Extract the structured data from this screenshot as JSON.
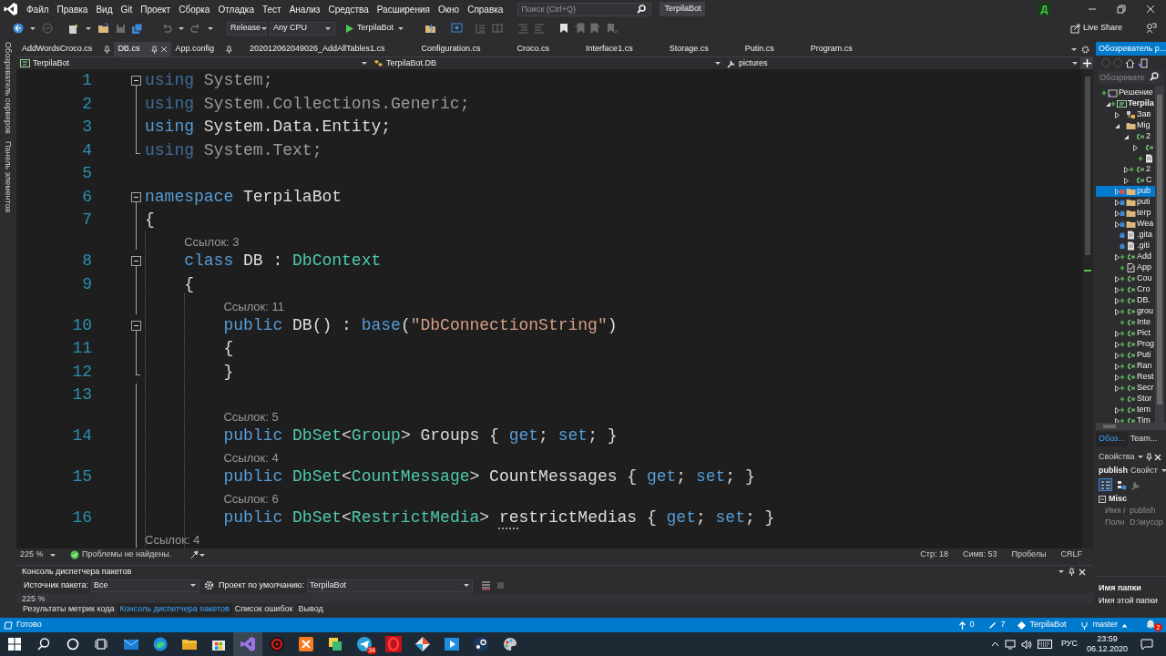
{
  "menu": {
    "items": [
      "Файл",
      "Правка",
      "Вид",
      "Git",
      "Проект",
      "Сборка",
      "Отладка",
      "Тест",
      "Анализ",
      "Средства",
      "Расширения",
      "Окно",
      "Справка"
    ],
    "search_placeholder": "Поиск (Ctrl+Q)",
    "solution_name": "TerpilaBot",
    "account_initial": "Д"
  },
  "toolbar": {
    "configuration": "Release",
    "platform": "Any CPU",
    "start": "TerpilaBot",
    "live_share": "Live Share"
  },
  "side_strip": [
    "Обозреватель серверов",
    "Панель элементов"
  ],
  "tabs": [
    {
      "label": "AddWordsCroco.cs",
      "pinned": true,
      "selected": false
    },
    {
      "label": "DB.cs",
      "pinned": true,
      "selected": true
    },
    {
      "label": "App.config",
      "pinned": true,
      "selected": false
    },
    {
      "label": "202012062049026_AddAllTables1.cs",
      "pinned": false,
      "selected": false
    },
    {
      "label": "Configuration.cs",
      "pinned": false,
      "selected": false
    },
    {
      "label": "Croco.cs",
      "pinned": false,
      "selected": false
    },
    {
      "label": "Interface1.cs",
      "pinned": false,
      "selected": false
    },
    {
      "label": "Storage.cs",
      "pinned": false,
      "selected": false
    },
    {
      "label": "Putin.cs",
      "pinned": false,
      "selected": false
    },
    {
      "label": "Program.cs",
      "pinned": false,
      "selected": false
    }
  ],
  "nav_bar": {
    "project": "TerpilaBot",
    "type": "TerpilaBot.DB",
    "member": "pictures"
  },
  "editor": {
    "lines": [
      {
        "kind": "code",
        "number": "1",
        "collapsible": true,
        "block_end": false,
        "in_block": true,
        "tokens": [
          {
            "kind": "kw_dim",
            "text": "using"
          },
          {
            "kind": "dim",
            "text": " System;"
          }
        ]
      },
      {
        "kind": "code",
        "number": "2",
        "collapsible": false,
        "block_end": false,
        "in_block": true,
        "tokens": [
          {
            "kind": "kw_dim",
            "text": "using"
          },
          {
            "kind": "dim",
            "text": " System.Collections.Generic;"
          }
        ]
      },
      {
        "kind": "code",
        "number": "3",
        "collapsible": false,
        "block_end": false,
        "in_block": true,
        "tokens": [
          {
            "kind": "kw",
            "text": "using"
          },
          {
            "kind": "text",
            "text": " System.Data.Entity;"
          }
        ]
      },
      {
        "kind": "code",
        "number": "4",
        "collapsible": false,
        "block_end": true,
        "in_block": true,
        "tokens": [
          {
            "kind": "kw_dim",
            "text": "using"
          },
          {
            "kind": "dim",
            "text": " System.Text;"
          }
        ]
      },
      {
        "kind": "code",
        "number": "5",
        "collapsible": false,
        "block_end": false,
        "in_block": false
      },
      {
        "kind": "code",
        "number": "6",
        "collapsible": true,
        "block_end": false,
        "in_block": true,
        "tokens": [
          {
            "kind": "kw",
            "text": "namespace"
          },
          {
            "kind": "text",
            "text": " TerpilaBot"
          }
        ]
      },
      {
        "kind": "code",
        "number": "7",
        "collapsible": false,
        "block_end": false,
        "in_block": true,
        "tokens": [
          {
            "kind": "text",
            "text": "{"
          }
        ]
      },
      {
        "kind": "lens",
        "text": "Ссылок: 3"
      },
      {
        "kind": "code",
        "number": "8",
        "collapsible": true,
        "block_end": false,
        "in_block": true,
        "tokens": [
          {
            "kind": "kw",
            "text": "    class"
          },
          {
            "kind": "text",
            "text": " DB : "
          },
          {
            "kind": "type",
            "text": "DbContext"
          }
        ]
      },
      {
        "kind": "code",
        "number": "9",
        "collapsible": false,
        "block_end": false,
        "in_block": true,
        "tokens": [
          {
            "kind": "text",
            "text": "    {"
          }
        ]
      },
      {
        "kind": "lens",
        "text": "Ссылок: 11"
      },
      {
        "kind": "code",
        "number": "10",
        "collapsible": true,
        "block_end": false,
        "in_block": true,
        "tokens": [
          {
            "kind": "kw",
            "text": "        public"
          },
          {
            "kind": "text",
            "text": " DB() : "
          },
          {
            "kind": "kw",
            "text": "base"
          },
          {
            "kind": "text",
            "text": "("
          },
          {
            "kind": "str",
            "text": "\"DbConnectionString\""
          },
          {
            "kind": "text",
            "text": ")"
          }
        ]
      },
      {
        "kind": "code",
        "number": "11",
        "collapsible": false,
        "block_end": false,
        "in_block": true,
        "tokens": [
          {
            "kind": "text",
            "text": "        {"
          }
        ]
      },
      {
        "kind": "code",
        "number": "12",
        "collapsible": false,
        "block_end": true,
        "in_block": true,
        "tokens": [
          {
            "kind": "text",
            "text": "        }"
          }
        ]
      },
      {
        "kind": "code",
        "number": "13",
        "collapsible": false,
        "block_end": false,
        "in_block": true
      },
      {
        "kind": "lens",
        "text": "Ссылок: 5"
      },
      {
        "kind": "code",
        "number": "14",
        "collapsible": false,
        "block_end": false,
        "in_block": true,
        "tokens": [
          {
            "kind": "kw",
            "text": "        public"
          },
          {
            "kind": "type",
            "text": " DbSet"
          },
          {
            "kind": "text",
            "text": "<"
          },
          {
            "kind": "type",
            "text": "Group"
          },
          {
            "kind": "text",
            "text": "> Groups { "
          },
          {
            "kind": "kw",
            "text": "get"
          },
          {
            "kind": "text",
            "text": "; "
          },
          {
            "kind": "kw",
            "text": "set"
          },
          {
            "kind": "text",
            "text": "; }"
          }
        ]
      },
      {
        "kind": "lens",
        "text": "Ссылок: 4"
      },
      {
        "kind": "code",
        "number": "15",
        "collapsible": false,
        "block_end": false,
        "in_block": true,
        "tokens": [
          {
            "kind": "kw",
            "text": "        public"
          },
          {
            "kind": "type",
            "text": " DbSet"
          },
          {
            "kind": "text",
            "text": "<"
          },
          {
            "kind": "type",
            "text": "CountMessage"
          },
          {
            "kind": "text",
            "text": "> CountMessages { "
          },
          {
            "kind": "kw",
            "text": "get"
          },
          {
            "kind": "text",
            "text": "; "
          },
          {
            "kind": "kw",
            "text": "set"
          },
          {
            "kind": "text",
            "text": "; }"
          }
        ]
      },
      {
        "kind": "lens",
        "text": "Ссылок: 6"
      },
      {
        "kind": "code",
        "number": "16",
        "collapsible": false,
        "block_end": false,
        "in_block": true,
        "tokens": [
          {
            "kind": "kw",
            "text": "        public"
          },
          {
            "kind": "type",
            "text": " DbSet"
          },
          {
            "kind": "text",
            "text": "<"
          },
          {
            "kind": "type",
            "text": "RestrictMedia"
          },
          {
            "kind": "text",
            "text": "> "
          },
          {
            "kind": "suggest",
            "text": "re"
          },
          {
            "kind": "text",
            "text": "strictMedias { "
          },
          {
            "kind": "kw",
            "text": "get"
          },
          {
            "kind": "text",
            "text": "; "
          },
          {
            "kind": "kw",
            "text": "set"
          },
          {
            "kind": "text",
            "text": "; }"
          }
        ]
      },
      {
        "kind": "lens",
        "text": "Ссылок: 4"
      }
    ]
  },
  "editor_status": {
    "zoom": "225 %",
    "issues": "Проблемы не найдены.",
    "line": "Стр: 18",
    "column": "Симв: 53",
    "whitespace": "Пробелы",
    "line_endings": "CRLF"
  },
  "package_console": {
    "title": "Консоль диспетчера пакетов",
    "source_label": "Источник пакета:",
    "source": "Все",
    "project_label": "Проект по умолчанию:",
    "project": "TerpilaBot",
    "zoom": "225 %"
  },
  "bottom_tabs": [
    {
      "label": "Результаты метрик кода",
      "selected": false
    },
    {
      "label": "Консоль диспетчера пакетов",
      "selected": true
    },
    {
      "label": "Список ошибок",
      "selected": false
    },
    {
      "label": "Вывод",
      "selected": false
    }
  ],
  "solution_explorer": {
    "title": "Обозреватель р...",
    "search_placeholder": "Обозревате",
    "tree": [
      {
        "label": "Решение",
        "kind": "solution",
        "added": true,
        "locked": false,
        "excluded": false,
        "selected": false,
        "children": [
          {
            "label": "Terpila",
            "kind": "project",
            "added": true,
            "locked": false,
            "excluded": false,
            "expanded": true,
            "selected": false,
            "children": [
              {
                "label": "Зав",
                "kind": "references",
                "added": false,
                "locked": false,
                "excluded": false,
                "expanded": false,
                "selected": false
              },
              {
                "label": "Mig",
                "kind": "folder",
                "added": false,
                "locked": false,
                "excluded": false,
                "expanded": true,
                "selected": false,
                "children": [
                  {
                    "label": "2",
                    "kind": "cs",
                    "added": false,
                    "locked": false,
                    "excluded": false,
                    "expanded": true,
                    "selected": false,
                    "children": [
                      {
                        "kind": "cs",
                        "added": false,
                        "locked": false,
                        "excluded": false,
                        "expanded": false,
                        "selected": false
                      },
                      {
                        "kind": "file",
                        "added": true,
                        "locked": false,
                        "excluded": false,
                        "selected": false
                      }
                    ]
                  },
                  {
                    "label": "2",
                    "kind": "cs",
                    "added": true,
                    "locked": false,
                    "excluded": false,
                    "expanded": false,
                    "selected": false
                  },
                  {
                    "label": "C",
                    "kind": "cs",
                    "added": false,
                    "locked": false,
                    "excluded": false,
                    "expanded": false,
                    "selected": false
                  }
                ]
              },
              {
                "label": "pub",
                "kind": "folder",
                "added": false,
                "locked": false,
                "excluded": true,
                "expanded": false,
                "selected": true
              },
              {
                "label": "puti",
                "kind": "folder",
                "added": false,
                "locked": true,
                "excluded": false,
                "expanded": false,
                "selected": false
              },
              {
                "label": "terp",
                "kind": "folder",
                "added": false,
                "locked": true,
                "excluded": false,
                "expanded": false,
                "selected": false
              },
              {
                "label": "Wea",
                "kind": "folder",
                "added": false,
                "locked": true,
                "excluded": false,
                "expanded": false,
                "selected": false
              },
              {
                "label": ".gita",
                "kind": "file",
                "added": false,
                "locked": true,
                "excluded": false,
                "selected": false
              },
              {
                "label": ".giti",
                "kind": "file",
                "added": false,
                "locked": true,
                "excluded": false,
                "selected": false
              },
              {
                "label": "Add",
                "kind": "cs",
                "added": true,
                "locked": false,
                "excluded": false,
                "expanded": false,
                "selected": false
              },
              {
                "label": "App",
                "kind": "config",
                "added": true,
                "locked": false,
                "excluded": false,
                "selected": false
              },
              {
                "label": "Cou",
                "kind": "cs",
                "added": true,
                "locked": false,
                "excluded": false,
                "expanded": false,
                "selected": false
              },
              {
                "label": "Cro",
                "kind": "cs",
                "added": true,
                "locked": false,
                "excluded": false,
                "expanded": false,
                "selected": false
              },
              {
                "label": "DB.",
                "kind": "cs",
                "added": true,
                "locked": false,
                "excluded": false,
                "expanded": false,
                "selected": false
              },
              {
                "label": "grou",
                "kind": "cs",
                "added": true,
                "locked": false,
                "excluded": false,
                "expanded": false,
                "selected": false
              },
              {
                "label": "Inte",
                "kind": "cs",
                "added": true,
                "locked": false,
                "excluded": false,
                "selected": false
              },
              {
                "label": "Pict",
                "kind": "cs",
                "added": true,
                "locked": false,
                "excluded": false,
                "expanded": false,
                "selected": false
              },
              {
                "label": "Prog",
                "kind": "cs",
                "added": true,
                "locked": false,
                "excluded": false,
                "expanded": false,
                "selected": false
              },
              {
                "label": "Puti",
                "kind": "cs",
                "added": true,
                "locked": false,
                "excluded": false,
                "expanded": false,
                "selected": false
              },
              {
                "label": "Ran",
                "kind": "cs",
                "added": true,
                "locked": false,
                "excluded": false,
                "expanded": false,
                "selected": false
              },
              {
                "label": "Rest",
                "kind": "cs",
                "added": true,
                "locked": false,
                "excluded": false,
                "expanded": false,
                "selected": false
              },
              {
                "label": "Secr",
                "kind": "cs",
                "added": true,
                "locked": false,
                "excluded": false,
                "expanded": false,
                "selected": false
              },
              {
                "label": "Stor",
                "kind": "cs",
                "added": true,
                "locked": false,
                "excluded": false,
                "selected": false
              },
              {
                "label": "tem",
                "kind": "cs",
                "added": true,
                "locked": false,
                "excluded": false,
                "expanded": false,
                "selected": false
              },
              {
                "label": "Tim",
                "kind": "cs",
                "added": true,
                "locked": false,
                "excluded": false,
                "expanded": false,
                "selected": false
              }
            ]
          }
        ]
      }
    ],
    "tabs": [
      {
        "label": "Обоз...",
        "selected": true
      },
      {
        "label": "Team...",
        "selected": false
      }
    ]
  },
  "properties": {
    "title": "Свойства",
    "object": "publish",
    "object_type": "Свойст",
    "category": "Misc",
    "rows": [
      {
        "name": "Имя г",
        "value": "publish"
      },
      {
        "name": "Полн",
        "value": "D:\\мусор"
      }
    ],
    "description_title": "Имя папки",
    "description": "Имя этой папки"
  },
  "status_bar": {
    "text": "Готово",
    "push": "0",
    "changes": "7",
    "repository": "TerpilaBot",
    "branch": "master",
    "notifications": "2"
  },
  "taskbar": {
    "apps": [
      {
        "kind": "start",
        "selected": false
      },
      {
        "kind": "search",
        "selected": false
      },
      {
        "kind": "cortana",
        "selected": false
      },
      {
        "kind": "taskview",
        "selected": false
      },
      {
        "kind": "mail",
        "selected": false
      },
      {
        "kind": "edge",
        "selected": false
      },
      {
        "kind": "explorer",
        "selected": false
      },
      {
        "kind": "store",
        "selected": false
      },
      {
        "kind": "vs",
        "selected": true
      },
      {
        "kind": "redring",
        "selected": false
      },
      {
        "kind": "xampp",
        "selected": false
      },
      {
        "kind": "notes",
        "selected": false
      },
      {
        "kind": "telegram",
        "selected": false,
        "badge": "34"
      },
      {
        "kind": "opera",
        "selected": false
      },
      {
        "kind": "diamond",
        "selected": false
      },
      {
        "kind": "media",
        "selected": false
      },
      {
        "kind": "steam",
        "selected": false
      },
      {
        "kind": "paint",
        "selected": false
      }
    ],
    "language": "РУС",
    "time": "23:59",
    "date": "06.12.2020"
  }
}
